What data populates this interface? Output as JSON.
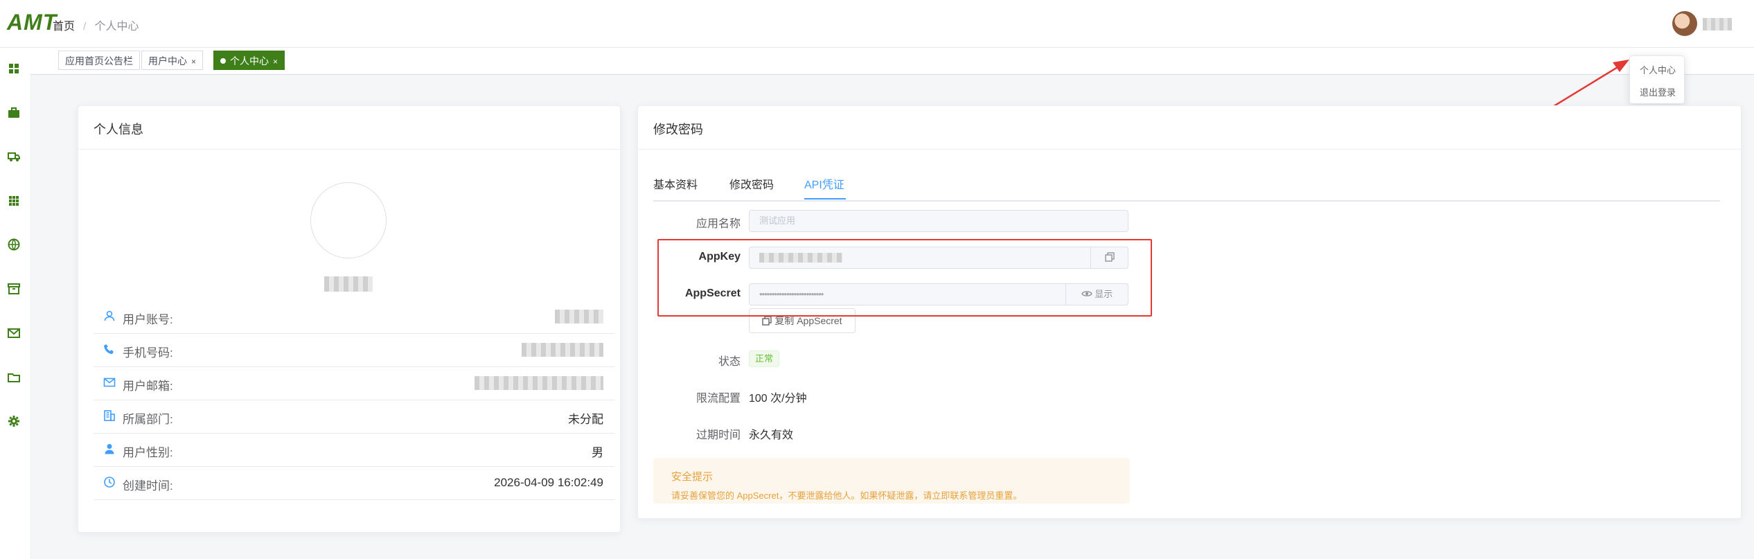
{
  "app": {
    "logo": "AMT"
  },
  "breadcrumb": {
    "home": "首页",
    "separator": "/",
    "current": "个人中心"
  },
  "sidebar": {
    "icons": [
      "dashboard-icon",
      "briefcase-icon",
      "truck-icon",
      "grid-icon",
      "globe-icon",
      "archive-icon",
      "mail-icon",
      "folder-icon",
      "gear-icon"
    ]
  },
  "tags": [
    {
      "label": "应用首页公告栏",
      "closable": false,
      "active": false
    },
    {
      "label": "用户中心",
      "closable": true,
      "active": false
    },
    {
      "label": "个人中心",
      "closable": true,
      "active": true
    }
  ],
  "tag_close": "×",
  "user_menu": {
    "items": [
      "个人中心",
      "退出登录"
    ]
  },
  "profile_card": {
    "title": "个人信息",
    "rows": [
      {
        "icon": "user-icon",
        "label": "用户账号:",
        "value": ""
      },
      {
        "icon": "phone-icon",
        "label": "手机号码:",
        "value": ""
      },
      {
        "icon": "mail-icon",
        "label": "用户邮箱:",
        "value": ""
      },
      {
        "icon": "building-icon",
        "label": "所属部门:",
        "value": "未分配"
      },
      {
        "icon": "person-icon",
        "label": "用户性别:",
        "value": "男"
      },
      {
        "icon": "clock-icon",
        "label": "创建时间:",
        "value": "2026-04-09 16:02:49"
      }
    ]
  },
  "settings_card": {
    "title": "修改密码",
    "tabs": [
      "基本资料",
      "修改密码",
      "API凭证"
    ],
    "active_tab": 2,
    "form": {
      "app_name_label": "应用名称",
      "app_name_placeholder": "测试应用",
      "appkey_label": "AppKey",
      "appsecret_label": "AppSecret",
      "appsecret_mask": "••••••••••••••••••••••••••",
      "show_label": "显示",
      "copy_secret_label": "复制 AppSecret",
      "status_label": "状态",
      "status_value": "正常",
      "rate_label": "限流配置",
      "rate_value": "100 次/分钟",
      "expire_label": "过期时间",
      "expire_value": "永久有效"
    },
    "alert": {
      "title": "安全提示",
      "desc": "请妥善保管您的 AppSecret，不要泄露给他人。如果怀疑泄露，请立即联系管理员重置。"
    }
  },
  "colors": {
    "brand": "#3f7f1a",
    "primary": "#409eff",
    "danger": "#e53935",
    "warning": "#e6a23c",
    "success": "#67c23a"
  }
}
